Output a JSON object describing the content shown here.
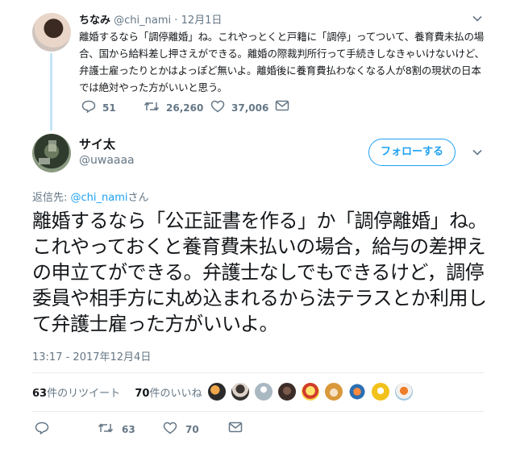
{
  "quoted_tweet": {
    "author_name": "ちなみ",
    "author_handle": "@chi_nami",
    "separator": "·",
    "date": "12月1日",
    "text": "離婚するなら「調停離婚」ね。これやっとくと戸籍に「調停」ってついて、養育費未払の場合、国から給料差し押さえができる。離婚の際裁判所行って手続きしなきゃいけないけど、弁護士雇ったりとかはよっぽど無いよ。離婚後に養育費払わなくなる人が8割の現状の日本では絶対やった方がいいと思う。",
    "replies": "51",
    "retweets": "26,260",
    "likes": "37,006"
  },
  "tweet": {
    "author_name": "サイ太",
    "author_handle": "@uwaaaa",
    "follow_label": "フォローする",
    "reply_prefix": "返信先: ",
    "reply_handle": "@chi_nami",
    "reply_suffix": "さん",
    "text": "離婚するなら「公正証書を作る」か「調停離婚」ね。これやっておくと養育費未払いの場合，給与の差押えの申立てができる。弁護士なしでもできるけど，調停委員や相手方に丸め込まれるから法テラスとか利用して弁護士雇った方がいいよ。",
    "timestamp": "13:17 - 2017年12月4日",
    "retweet_count": "63",
    "retweet_label": "件のリツイート",
    "like_count": "70",
    "like_label": "件のいいね",
    "action_retweets": "63",
    "action_likes": "70"
  },
  "colors": {
    "accent": "#1da1f2",
    "muted": "#657786",
    "text": "#14171a",
    "thread_line": "#c4e4f8",
    "divider": "#e6ecf0"
  },
  "icons": {
    "reply": "reply-icon",
    "retweet": "retweet-icon",
    "like": "heart-icon",
    "dm": "envelope-icon",
    "menu": "chevron-down-icon"
  }
}
